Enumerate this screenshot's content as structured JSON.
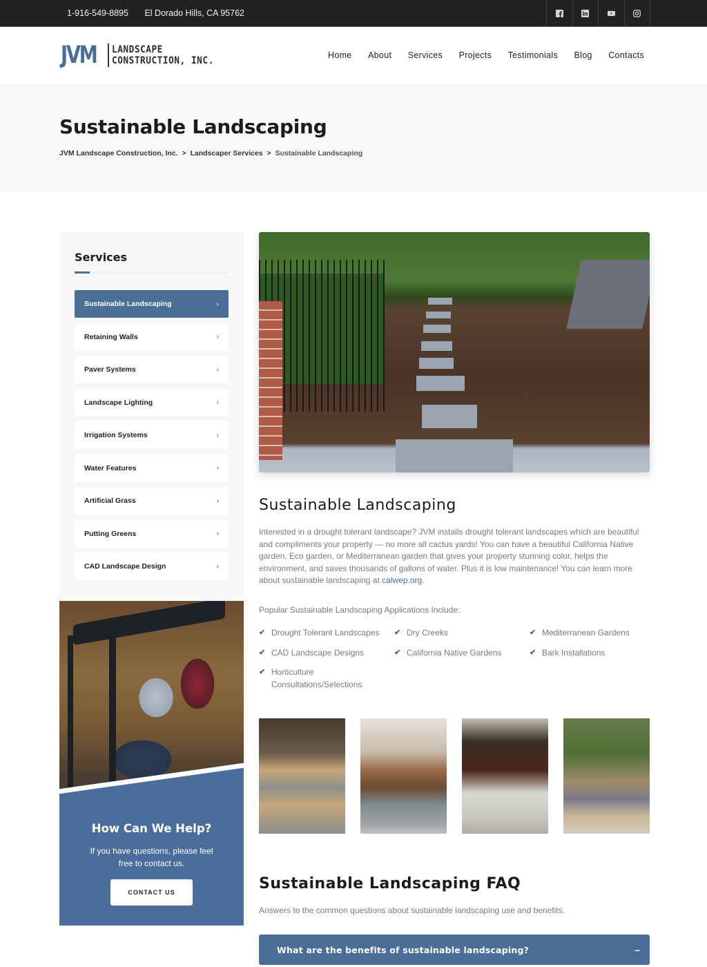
{
  "topbar": {
    "phone": "1-916-549-8895",
    "location": "El Dorado Hills, CA 95762",
    "socials": [
      {
        "name": "facebook-icon"
      },
      {
        "name": "linkedin-icon"
      },
      {
        "name": "youtube-icon"
      },
      {
        "name": "instagram-icon"
      }
    ]
  },
  "header": {
    "logo": {
      "mark": "JVM",
      "line1": "LANDSCAPE",
      "line2": "CONSTRUCTION, INC."
    },
    "nav": [
      "Home",
      "About",
      "Services",
      "Projects",
      "Testimonials",
      "Blog",
      "Contacts"
    ]
  },
  "banner": {
    "title": "Sustainable Landscaping",
    "breadcrumb": [
      "JVM Landscape Construction, Inc.",
      "Landscaper Services",
      "Sustainable Landscaping"
    ],
    "separator": ">"
  },
  "sidebar": {
    "title": "Services",
    "items": [
      {
        "label": "Sustainable Landscaping",
        "active": true
      },
      {
        "label": "Retaining Walls",
        "active": false
      },
      {
        "label": "Paver Systems",
        "active": false
      },
      {
        "label": "Landscape Lighting",
        "active": false
      },
      {
        "label": "Irrigation Systems",
        "active": false
      },
      {
        "label": "Water Features",
        "active": false
      },
      {
        "label": "Artificial Grass",
        "active": false
      },
      {
        "label": "Putting Greens",
        "active": false
      },
      {
        "label": "CAD Landscape Design",
        "active": false
      }
    ],
    "chevron": "›"
  },
  "help": {
    "title": "How Can We Help?",
    "text": "If you have questions, please feel free to contact us.",
    "button": "CONTACT US"
  },
  "main": {
    "title": "Sustainable Landscaping",
    "intro_text": "Interested in a drought tolerant landscape? JVM installs drought tolerant landscapes which are beautiful and compliments your property — no more all cactus yards! You can have a beautiful California Native garden, Eco garden, or Mediterranean garden that gives your property stunning color, helps the environment, and saves thousands of gallons of water. Plus it is low maintenance!  You can learn more about sustainable landscaping at ",
    "intro_link": "calwep.org",
    "intro_end": ".",
    "apps_lead": "Popular Sustainable Landscaping Applications Include:",
    "apps": [
      "Drought Tolerant Landscapes",
      "Dry Creeks",
      "Mediterranean Gardens",
      "CAD Landscape Designs",
      "California Native Gardens",
      "Bark Installations",
      "Horticulture Consultations/Selections"
    ],
    "check_glyph": "✔",
    "faq_title": "Sustainable Landscaping FAQ",
    "faq_sub": "Answers to the common questions about sustainable landscaping use and benefits.",
    "faq": [
      {
        "question": "What are the benefits of sustainable landscaping?",
        "expanded": true,
        "toggle": "–"
      }
    ]
  },
  "colors": {
    "accent": "#4b6e98",
    "topbar": "#222222",
    "banner_bg": "#f7f8fa",
    "body_text": "#7a7a7a"
  }
}
